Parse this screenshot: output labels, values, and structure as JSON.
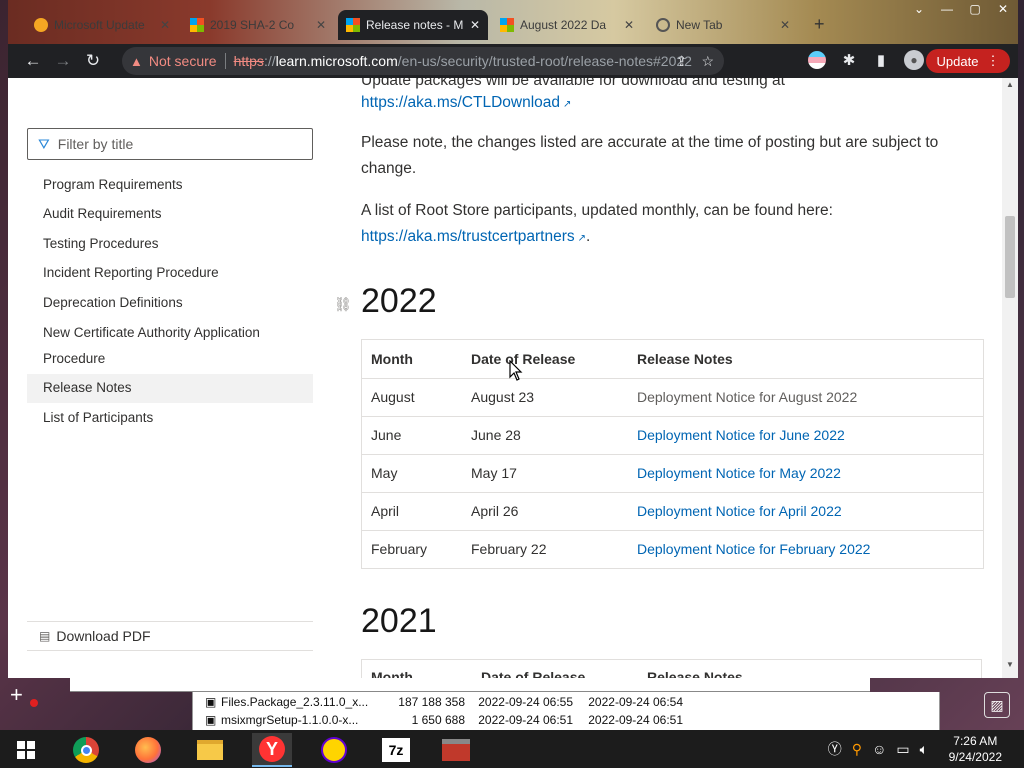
{
  "browser": {
    "tabs": [
      {
        "label": "Microsoft Update",
        "active": false
      },
      {
        "label": "2019 SHA-2 Co",
        "active": false
      },
      {
        "label": "Release notes - M",
        "active": true
      },
      {
        "label": "August 2022 Da",
        "active": false
      },
      {
        "label": "New Tab",
        "active": false
      }
    ],
    "security_label": "Not secure",
    "url_scheme": "https",
    "url_sep": "://",
    "url_host": "learn.microsoft.com",
    "url_path": "/en-us/security/trusted-root/release-notes#2022",
    "update_label": "Update"
  },
  "sidebar": {
    "filter_placeholder": "Filter by title",
    "items": [
      {
        "label": "Program Requirements"
      },
      {
        "label": "Audit Requirements"
      },
      {
        "label": "Testing Procedures"
      },
      {
        "label": "Incident Reporting Procedure"
      },
      {
        "label": "Deprecation Definitions"
      },
      {
        "label": "New Certificate Authority Application Procedure"
      },
      {
        "label": "Release Notes"
      },
      {
        "label": "List of Participants"
      }
    ],
    "download_pdf": "Download PDF"
  },
  "content": {
    "partial_top": "Update packages will be available for download and testing at",
    "ctl_link": "https://aka.ms/CTLDownload",
    "note": "Please note, the changes listed are accurate at the time of posting but are subject to change.",
    "participants_text": "A list of Root Store participants, updated monthly, can be found here:",
    "participants_link": "https://aka.ms/trustcertpartners",
    "heading_2022": "2022",
    "heading_2021": "2021",
    "table_headers": [
      "Month",
      "Date of Release",
      "Release Notes"
    ],
    "rows": [
      {
        "month": "August",
        "date": "August 23",
        "notes": "Deployment Notice for August 2022"
      },
      {
        "month": "June",
        "date": "June 28",
        "notes": "Deployment Notice for June 2022"
      },
      {
        "month": "May",
        "date": "May 17",
        "notes": "Deployment Notice for May 2022"
      },
      {
        "month": "April",
        "date": "April 26",
        "notes": "Deployment Notice for April 2022"
      },
      {
        "month": "February",
        "date": "February 22",
        "notes": "Deployment Notice for February 2022"
      }
    ],
    "table_2021_headers_partial": [
      "Month",
      "Date of Release",
      "Release Notes"
    ]
  },
  "file_manager": {
    "files": [
      {
        "name": "Files.Package_2.3.11.0_x...",
        "size": "187 188 358",
        "modified": "2022-09-24 06:55",
        "created": "2022-09-24 06:54"
      },
      {
        "name": "msixmgrSetup-1.1.0.0-x...",
        "size": "1 650 688",
        "modified": "2022-09-24 06:51",
        "created": "2022-09-24 06:51"
      }
    ]
  },
  "taskbar": {
    "time": "7:26 AM",
    "date": "9/24/2022"
  }
}
